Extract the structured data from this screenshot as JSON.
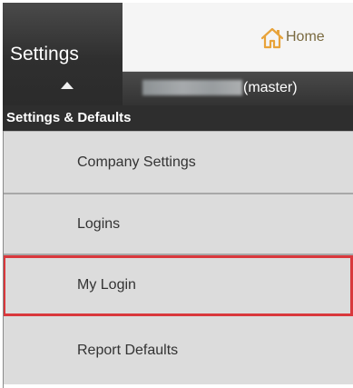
{
  "settings_tab": {
    "title": "Settings"
  },
  "top_bar": {
    "home_label": "Home"
  },
  "user_bar": {
    "account_suffix": "(master)"
  },
  "section": {
    "header": "Settings & Defaults"
  },
  "menu": {
    "items": [
      {
        "label": "Company Settings",
        "selected": false
      },
      {
        "label": "Logins",
        "selected": false
      },
      {
        "label": "My Login",
        "selected": true
      },
      {
        "label": "Report Defaults",
        "selected": false
      }
    ]
  },
  "colors": {
    "dark_bg": "#2e2e2e",
    "menu_bg": "#dcdcdc",
    "selected_outline": "#d9383c",
    "home_icon": "#e8a33a"
  },
  "icons": {
    "home": "home-icon",
    "caret": "caret-up-icon"
  }
}
